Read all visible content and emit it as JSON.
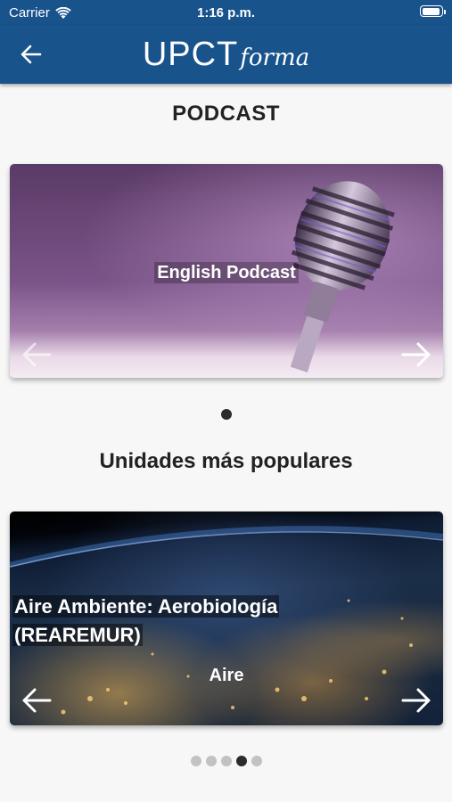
{
  "status_bar": {
    "carrier": "Carrier",
    "time": "1:16 p.m."
  },
  "nav": {
    "logo_main": "UPCT",
    "logo_sub": "forma",
    "back_icon": "arrow-left-icon",
    "color": "#18538c"
  },
  "podcast_section": {
    "title": "PODCAST",
    "slides": [
      {
        "label": "English Podcast"
      }
    ],
    "active_index": 0
  },
  "units_section": {
    "title": "Unidades más populares",
    "slides": [
      {
        "title": "Aire Ambiente: Aerobiología (REAREMUR)",
        "subtitle": "Aire"
      }
    ],
    "dots_count": 5,
    "active_index": 3
  },
  "colors": {
    "header": "#18538c",
    "background": "#f7f7f7",
    "dot_active": "#2b2b2b",
    "dot_inactive": "#c2c2c2"
  }
}
